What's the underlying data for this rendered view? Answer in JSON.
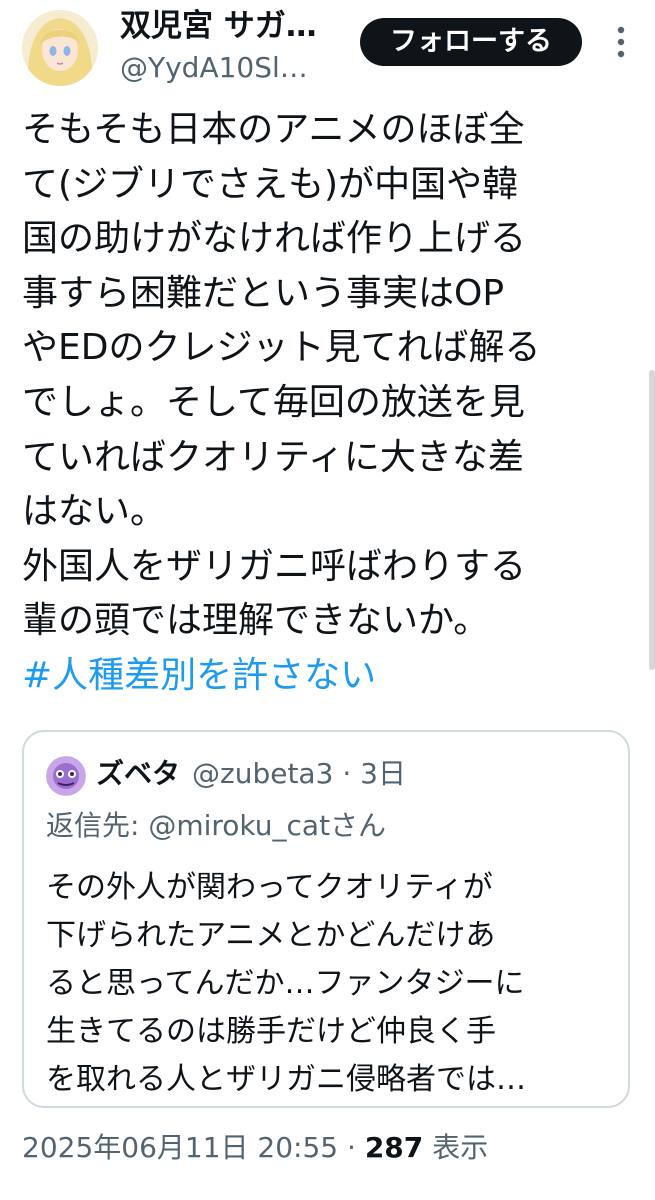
{
  "author": {
    "display_name": "双児宮 サガ…",
    "handle": "@YydA10Sl…",
    "avatar_icon": "anime-avatar-icon"
  },
  "follow_button": {
    "label": "フォローする"
  },
  "more_icon": "more-vertical-icon",
  "tweet": {
    "lines": [
      "そもそも日本のアニメのほぼ全",
      "て(ジブリでさえも)が中国や韓",
      "国の助けがなければ作り上げる",
      "事すら困難だという事実はOP",
      "やEDのクレジット見てれば解る",
      "でしょ。そして毎回の放送を見",
      "ていればクオリティに大きな差",
      "はない。",
      "外国人をザリガニ呼ばわりする",
      "輩の頭では理解できないか。"
    ],
    "hashtag": "#人種差別を許さない"
  },
  "quoted_tweet": {
    "display_name": "ズベタ",
    "handle": "@zubeta3",
    "separator": "·",
    "time": "3日",
    "reply_prefix": "返信先: ",
    "reply_to": "@miroku_catさん",
    "lines": [
      "その外人が関わってクオリティが",
      "下げられたアニメとかどんだけあ",
      "ると思ってんだか…ファンタジーに",
      "生きてるのは勝手だけど仲良く手",
      "を取れる人とザリガニ侵略者では…"
    ]
  },
  "footer": {
    "timestamp": "2025年06月11日 20:55",
    "separator": "·",
    "views_count": "287",
    "views_label": "表示"
  },
  "colors": {
    "text": "#0f1419",
    "secondary": "#536471",
    "hashtag": "#1d9bf0",
    "border": "#cfd9de",
    "button_bg": "#0f1419"
  }
}
